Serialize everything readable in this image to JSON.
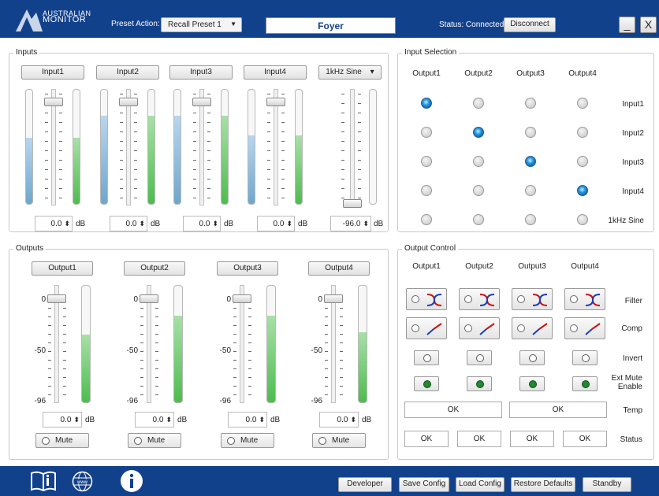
{
  "header": {
    "logo_line1": "AUSTRALIAN",
    "logo_line2": "MONITOR",
    "preset_label": "Preset Action:",
    "preset_value": "Recall Preset 1",
    "title": "Foyer",
    "status": "Status: Connected",
    "disconnect": "Disconnect",
    "minimize": "_",
    "close": "X"
  },
  "inputs": {
    "title": "Inputs",
    "unit": "dB",
    "channels": [
      {
        "name": "Input1",
        "value": "0.0",
        "level": 0.58,
        "meter": 0.58
      },
      {
        "name": "Input2",
        "value": "0.0",
        "level": 0.77,
        "meter": 0.77
      },
      {
        "name": "Input3",
        "value": "0.0",
        "level": 0.77,
        "meter": 0.77
      },
      {
        "name": "Input4",
        "value": "0.0",
        "level": 0.6,
        "meter": 0.6
      }
    ],
    "sine": {
      "name": "1kHz Sine",
      "value": "-96.0"
    }
  },
  "input_selection": {
    "title": "Input Selection",
    "columns": [
      "Output1",
      "Output2",
      "Output3",
      "Output4"
    ],
    "rows": [
      "Input1",
      "Input2",
      "Input3",
      "Input4",
      "1kHz Sine"
    ],
    "selected": [
      0,
      1,
      2,
      3
    ]
  },
  "outputs": {
    "title": "Outputs",
    "unit": "dB",
    "scale": [
      "0",
      "-50",
      "-96"
    ],
    "mute": "Mute",
    "channels": [
      {
        "name": "Output1",
        "value": "0.0",
        "meter": 0.58
      },
      {
        "name": "Output2",
        "value": "0.0",
        "meter": 0.74
      },
      {
        "name": "Output3",
        "value": "0.0",
        "meter": 0.74
      },
      {
        "name": "Output4",
        "value": "0.0",
        "meter": 0.6
      }
    ]
  },
  "output_control": {
    "title": "Output Control",
    "columns": [
      "Output1",
      "Output2",
      "Output3",
      "Output4"
    ],
    "rows": {
      "filter": "Filter",
      "comp": "Comp",
      "invert": "Invert",
      "ext_mute": "Ext Mute\nEnable",
      "temp": "Temp",
      "status": "Status"
    },
    "temp_values": [
      "OK",
      "OK"
    ],
    "status_values": [
      "OK",
      "OK",
      "OK",
      "OK"
    ]
  },
  "footer": {
    "developer": "Developer",
    "save": "Save Config",
    "load": "Load Config",
    "restore": "Restore Defaults",
    "standby": "Standby",
    "www": "www"
  }
}
